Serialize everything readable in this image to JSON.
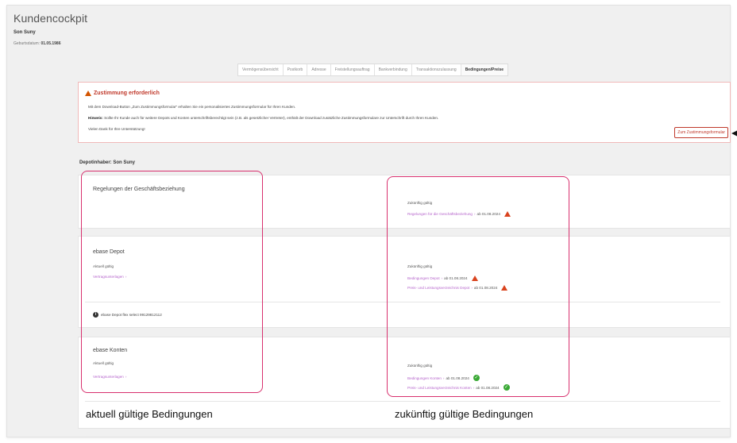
{
  "header": {
    "app_title": "Kundencockpit",
    "customer_name": "Son Suny",
    "birth_label": "Geburtsdatum:",
    "birth_value": "01.05.1986"
  },
  "tabs": [
    {
      "label": "Vermögensübersicht",
      "active": false
    },
    {
      "label": "Postkorb",
      "active": false
    },
    {
      "label": "Adresse",
      "active": false
    },
    {
      "label": "Freistellungsauftrag",
      "active": false
    },
    {
      "label": "Bankverbindung",
      "active": false
    },
    {
      "label": "Transaktionszulassung",
      "active": false
    },
    {
      "label": "Bedingungen/Preise",
      "active": true
    }
  ],
  "alert": {
    "title": "Zustimmung erforderlich",
    "line1": "Mit dem Download-Button „Zum Zustimmungsformular“ erhalten Sie ein personalisiertes Zustimmungsformular für Ihren Kunden.",
    "hint_label": "Hinweis:",
    "line2": "Sollte Ihr Kunde auch für weitere Depots und Konten unterschriftsberechtigt sein (z.B. als gesetzlicher Vertreter), enthält der Download zusätzliche Zustimmungsformulare zur Unterschrift durch Ihren Kunden.",
    "line3": "Vielen Dank für Ihre Unterstützung!",
    "button": "Zum Zustimmungsformular"
  },
  "holder": "Depotinhaber: Son Suny",
  "cards": {
    "relations": {
      "title": "Regelungen der Geschäftsbeziehung",
      "future_label": "Zukünftig gültig",
      "future_link": "Regelungen für die Geschäftsbeziehung",
      "future_date": "ab 01.08.2024"
    },
    "depot": {
      "title": "ebase Depot",
      "current_label": "Aktuell gültig",
      "current_link": "Vertragsunterlagen",
      "future_label": "Zukünftig gültig",
      "future_link1": "Bedingungen Depot",
      "future_date1": "ab 01.08.2024",
      "future_link2": "Preis- und Leistungsverzeichnis Depot",
      "future_date2": "ab 01.08.2024",
      "info": "ebase Depot flex select 99129812112"
    },
    "accounts": {
      "title": "ebase Konten",
      "current_label": "Aktuell gültig",
      "current_link": "Vertragsunterlagen",
      "future_label": "Zukünftig gültig",
      "future_link1": "Bedingungen Konten",
      "future_date1": "ab 01.08.2024",
      "future_link2": "Preis- und Leistungsverzeichnis Konten",
      "future_date2": "ab 01.08.2024"
    }
  },
  "captions": {
    "left": "aktuell gültige Bedingungen",
    "right": "zukünftig gültige Bedingungen"
  },
  "colors": {
    "accent_link": "#b666cc",
    "warning": "#d9431e",
    "ok": "#3aa935",
    "highlight": "#d8306e"
  }
}
